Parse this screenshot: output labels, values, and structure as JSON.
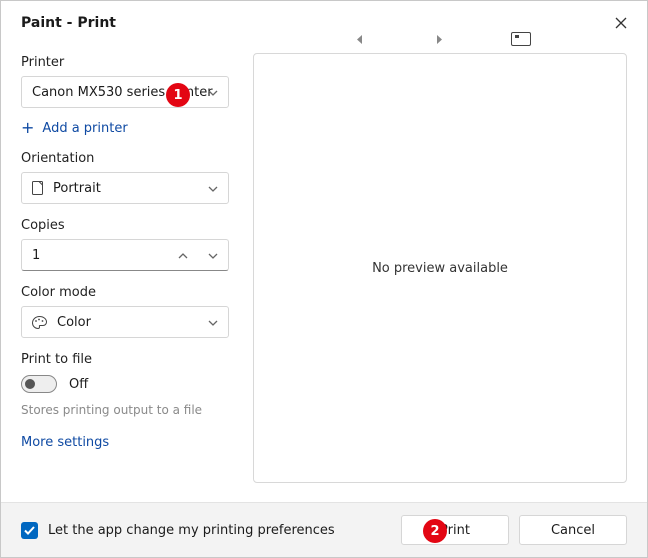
{
  "window": {
    "title": "Paint - Print"
  },
  "printer": {
    "label": "Printer",
    "value": "Canon MX530 series Printer",
    "add_link": "Add a printer"
  },
  "orientation": {
    "label": "Orientation",
    "value": "Portrait"
  },
  "copies": {
    "label": "Copies",
    "value": "1"
  },
  "color_mode": {
    "label": "Color mode",
    "value": "Color"
  },
  "print_to_file": {
    "label": "Print to file",
    "state": "Off",
    "description": "Stores printing output to a file"
  },
  "more_settings": "More settings",
  "preview": {
    "no_preview": "No preview available"
  },
  "footer": {
    "checkbox_label": "Let the app change my printing preferences",
    "print": "Print",
    "cancel": "Cancel"
  },
  "annotations": {
    "step1": "1",
    "step2": "2"
  }
}
